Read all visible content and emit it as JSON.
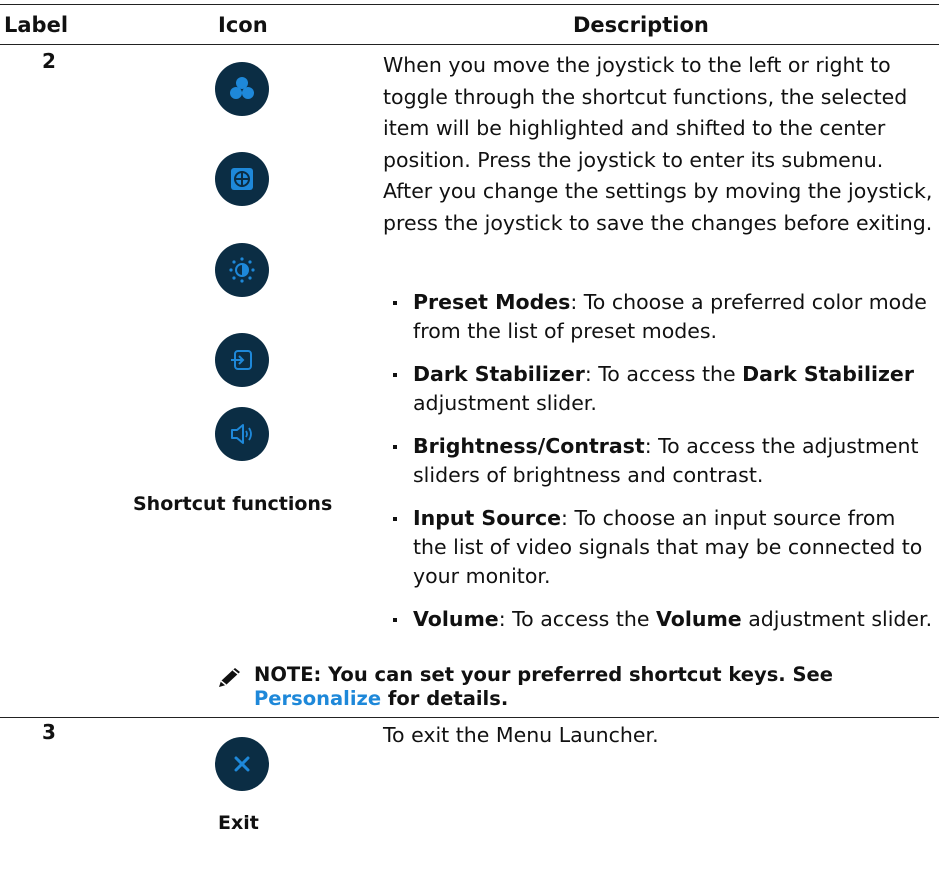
{
  "header": {
    "label": "Label",
    "icon": "Icon",
    "description": "Description"
  },
  "rows": [
    {
      "label": "2",
      "icons": [
        "preset-modes-icon",
        "dark-stabilizer-icon",
        "brightness-contrast-icon",
        "input-source-icon",
        "volume-icon"
      ],
      "caption": "Shortcut functions",
      "description": "When you move the joystick to the left or right to toggle through the shortcut functions, the selected item will be highlighted and shifted to the center position. Press the joystick to enter its submenu. After you change the settings by moving the joystick, press the joystick to save the changes before exiting.",
      "bullets": [
        {
          "term": "Preset Modes",
          "text": ": To choose a preferred color mode from the list of preset modes."
        },
        {
          "term": "Dark Stabilizer",
          "text_a": ": To access the ",
          "term2": "Dark Stabilizer",
          "text_b": " adjustment slider."
        },
        {
          "term": "Brightness/Contrast",
          "text": ": To access the adjustment sliders of brightness and contrast."
        },
        {
          "term": "Input Source",
          "text": ": To choose an input source from the list of video signals that may be connected to your monitor."
        },
        {
          "term": "Volume",
          "text_a": ": To access the ",
          "term2": "Volume",
          "text_b": " adjustment slider."
        }
      ],
      "note": {
        "prefix": "NOTE: You can set your preferred shortcut keys. See ",
        "link": "Personalize",
        "suffix": " for details."
      }
    },
    {
      "label": "3",
      "icon": "close-icon",
      "caption": "Exit",
      "description": "To exit the Menu Launcher."
    }
  ],
  "colors": {
    "icon_bg": "#0b2d44",
    "icon_accent": "#1e88d9",
    "link": "#1e88d9"
  }
}
